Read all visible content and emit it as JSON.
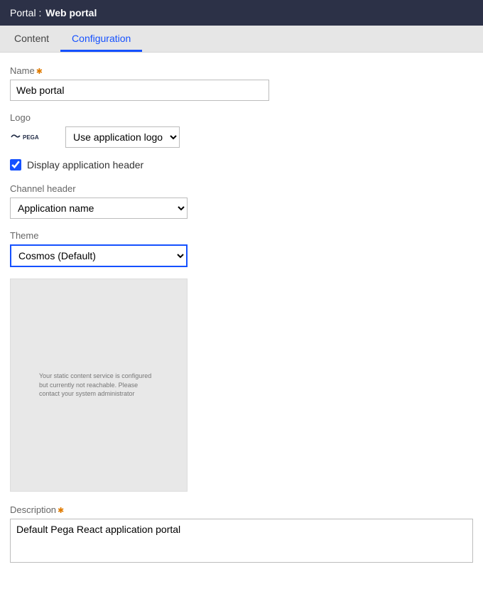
{
  "header": {
    "portal_label": "Portal :",
    "portal_name": "Web portal"
  },
  "tabs": {
    "content": "Content",
    "configuration": "Configuration"
  },
  "fields": {
    "name_label": "Name",
    "name_value": "Web portal",
    "logo_label": "Logo",
    "logo_select_value": "Use application logo",
    "display_header_label": "Display application header",
    "channel_header_label": "Channel header",
    "channel_header_value": "Application name",
    "theme_label": "Theme",
    "theme_value": "Cosmos (Default)",
    "preview_message": "Your static content service is configured but currently not reachable. Please contact your system administrator",
    "description_label": "Description",
    "description_value": "Default Pega React application portal"
  },
  "logo_text": "PEGA"
}
